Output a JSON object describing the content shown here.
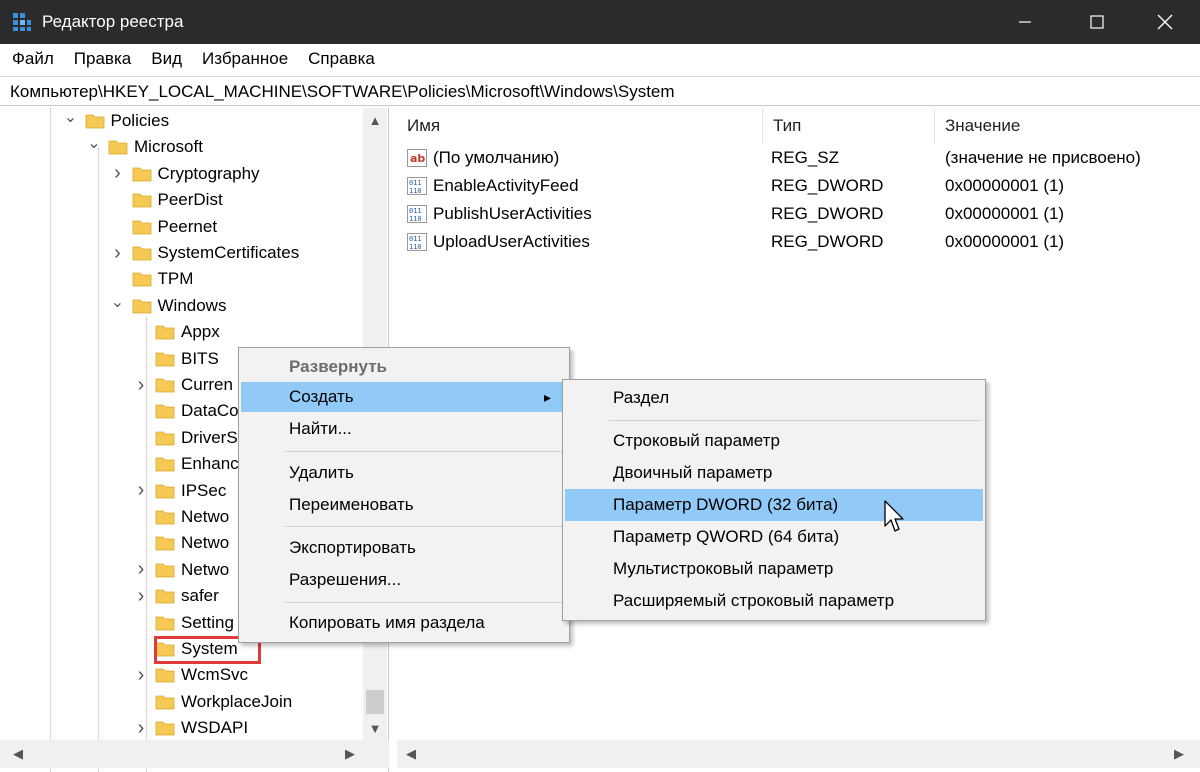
{
  "window": {
    "title": "Редактор реестра",
    "accent": "#2b2b2b"
  },
  "menubar": [
    "Файл",
    "Правка",
    "Вид",
    "Избранное",
    "Справка"
  ],
  "address": "Компьютер\\HKEY_LOCAL_MACHINE\\SOFTWARE\\Policies\\Microsoft\\Windows\\System",
  "tree": [
    {
      "label": "Policies",
      "expanded": true
    },
    {
      "label": "Microsoft",
      "expanded": true
    },
    {
      "label": "Cryptography",
      "expanded": false
    },
    {
      "label": "PeerDist"
    },
    {
      "label": "Peernet"
    },
    {
      "label": "SystemCertificates",
      "expanded": false
    },
    {
      "label": "TPM"
    },
    {
      "label": "Windows",
      "expanded": true
    },
    {
      "label": "Appx"
    },
    {
      "label": "BITS"
    },
    {
      "label": "Curren",
      "expanded": false
    },
    {
      "label": "DataCo"
    },
    {
      "label": "DriverS"
    },
    {
      "label": "Enhanc"
    },
    {
      "label": "IPSec",
      "expanded": false
    },
    {
      "label": "Netwo"
    },
    {
      "label": "Netwo"
    },
    {
      "label": "Netwo",
      "expanded": false
    },
    {
      "label": "safer",
      "expanded": false
    },
    {
      "label": "Setting"
    },
    {
      "label": "System",
      "selected": true
    },
    {
      "label": "WcmSvc",
      "expanded": false
    },
    {
      "label": "WorkplaceJoin"
    },
    {
      "label": "WSDAPI",
      "expanded": false
    }
  ],
  "list": {
    "columns": [
      "Имя",
      "Тип",
      "Значение"
    ],
    "rows": [
      {
        "icon": "string-value-icon",
        "name": "(По умолчанию)",
        "type": "REG_SZ",
        "value": "(значение не присвоено)"
      },
      {
        "icon": "binary-value-icon",
        "name": "EnableActivityFeed",
        "type": "REG_DWORD",
        "value": "0x00000001 (1)"
      },
      {
        "icon": "binary-value-icon",
        "name": "PublishUserActivities",
        "type": "REG_DWORD",
        "value": "0x00000001 (1)"
      },
      {
        "icon": "binary-value-icon",
        "name": "UploadUserActivities",
        "type": "REG_DWORD",
        "value": "0x00000001 (1)"
      }
    ]
  },
  "context_menu": {
    "items": [
      "Развернуть",
      "Создать",
      "Найти...",
      "Удалить",
      "Переименовать",
      "Экспортировать",
      "Разрешения...",
      "Копировать имя раздела"
    ],
    "highlight_color": "#91c9f7"
  },
  "submenu": {
    "items": [
      "Раздел",
      "Строковый параметр",
      "Двоичный параметр",
      "Параметр DWORD (32 бита)",
      "Параметр QWORD (64 бита)",
      "Мультистроковый параметр",
      "Расширяемый строковый параметр"
    ]
  },
  "colors": {
    "folder": "#f5c954",
    "selection_outline": "#e03a3a"
  }
}
